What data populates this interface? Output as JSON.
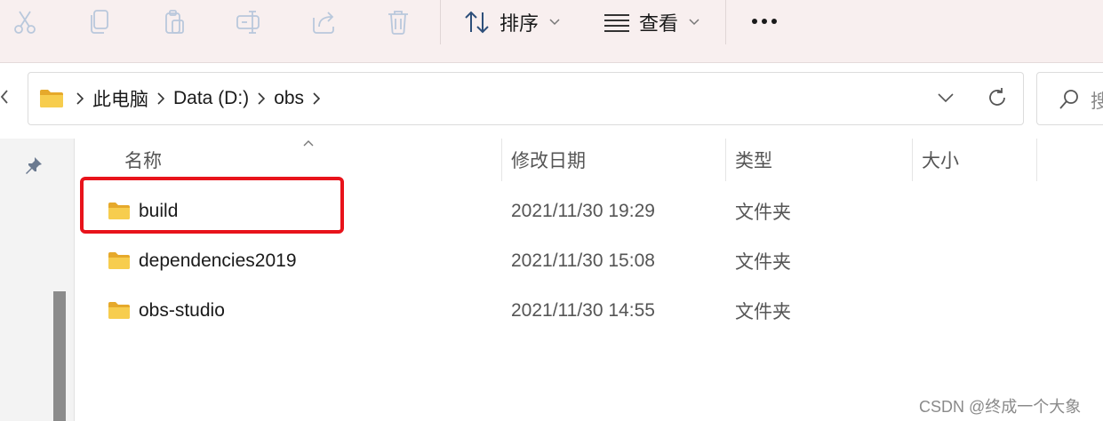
{
  "toolbar": {
    "icons": [
      "cut-icon",
      "copy-icon",
      "paste-icon",
      "rename-icon",
      "share-icon",
      "delete-icon"
    ],
    "sort_label": "排序",
    "view_label": "查看",
    "more_label": "..."
  },
  "address": {
    "segments": [
      "此电脑",
      "Data (D:)",
      "obs"
    ]
  },
  "search": {
    "placeholder": "搜"
  },
  "columns": {
    "name": "名称",
    "date": "修改日期",
    "type": "类型",
    "size": "大小"
  },
  "files": [
    {
      "name": "build",
      "date": "2021/11/30 19:29",
      "type": "文件夹"
    },
    {
      "name": "dependencies2019",
      "date": "2021/11/30 15:08",
      "type": "文件夹"
    },
    {
      "name": "obs-studio",
      "date": "2021/11/30 14:55",
      "type": "文件夹"
    }
  ],
  "watermark": "CSDN @终成一个大象",
  "colors": {
    "highlight": "#e8131b",
    "folder": "#f4c542",
    "accent": "#0067c0"
  }
}
